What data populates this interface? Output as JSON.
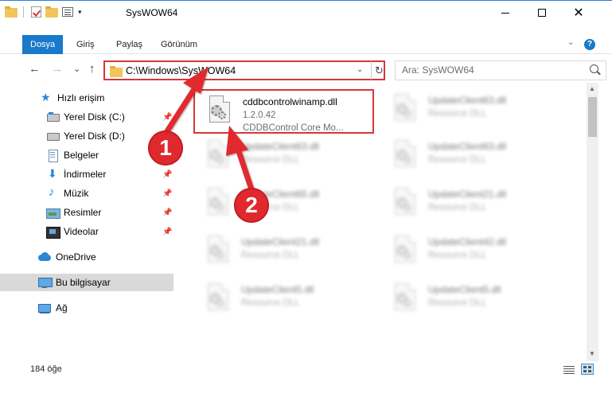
{
  "window": {
    "title": "SysWOW64",
    "qa_dropdown": "▾"
  },
  "ribbon": {
    "tabs": [
      {
        "label": "Dosya",
        "active": true
      },
      {
        "label": "Giriş",
        "active": false
      },
      {
        "label": "Paylaş",
        "active": false
      },
      {
        "label": "Görünüm",
        "active": false
      }
    ],
    "help": "?"
  },
  "nav": {
    "back": "←",
    "forward": "→",
    "recent": "⌄",
    "up": "↑",
    "address": "C:\\Windows\\SysWOW64",
    "address_dropdown": "⌄",
    "refresh": "↻",
    "search_placeholder": "Ara: SysWOW64"
  },
  "sidebar": {
    "items": [
      {
        "label": "Hızlı erişim",
        "icon": "star-icon",
        "pinned": false
      },
      {
        "label": "Yerel Disk (C:)",
        "icon": "drive-icon",
        "pinned": true
      },
      {
        "label": "Yerel Disk (D:)",
        "icon": "drive-icon",
        "pinned": false
      },
      {
        "label": "Belgeler",
        "icon": "documents-icon",
        "pinned": true
      },
      {
        "label": "İndirmeler",
        "icon": "download-icon",
        "pinned": true
      },
      {
        "label": "Müzik",
        "icon": "music-icon",
        "pinned": true
      },
      {
        "label": "Resimler",
        "icon": "pictures-icon",
        "pinned": true
      },
      {
        "label": "Videolar",
        "icon": "videos-icon",
        "pinned": true
      },
      {
        "label": "OneDrive",
        "icon": "cloud-icon",
        "pinned": false
      },
      {
        "label": "Bu bilgisayar",
        "icon": "computer-icon",
        "pinned": false,
        "selected": true
      },
      {
        "label": "Ağ",
        "icon": "network-icon",
        "pinned": false
      }
    ],
    "pin_glyph": "📌"
  },
  "files": {
    "highlighted": {
      "name": "cddbcontrolwinamp.dll",
      "version": "1.2.0.42",
      "description": "CDDBControl Core Mo..."
    },
    "blurred": [
      {
        "name": "UpdateClient63.dll",
        "type": "Resource DLL"
      },
      {
        "name": "UpdateClient63.dll",
        "type": "Resource DLL"
      },
      {
        "name": "UpdateClient63.dll",
        "type": "Resource DLL"
      },
      {
        "name": "UpdateClient65.dll",
        "type": "Resource DLL"
      },
      {
        "name": "UpdateClient21.dll",
        "type": "Resource DLL"
      },
      {
        "name": "UpdateClient21.dll",
        "type": "Resource DLL"
      },
      {
        "name": "UpdateClient42.dll",
        "type": "Resource DLL"
      },
      {
        "name": "UpdateClient5.dll",
        "type": "Resource DLL"
      },
      {
        "name": "UpdateClient5.dll",
        "type": "Resource DLL"
      }
    ]
  },
  "status": {
    "count": "184 öğe"
  },
  "annotations": {
    "step1": "1",
    "step2": "2",
    "color": "#e0292e"
  }
}
